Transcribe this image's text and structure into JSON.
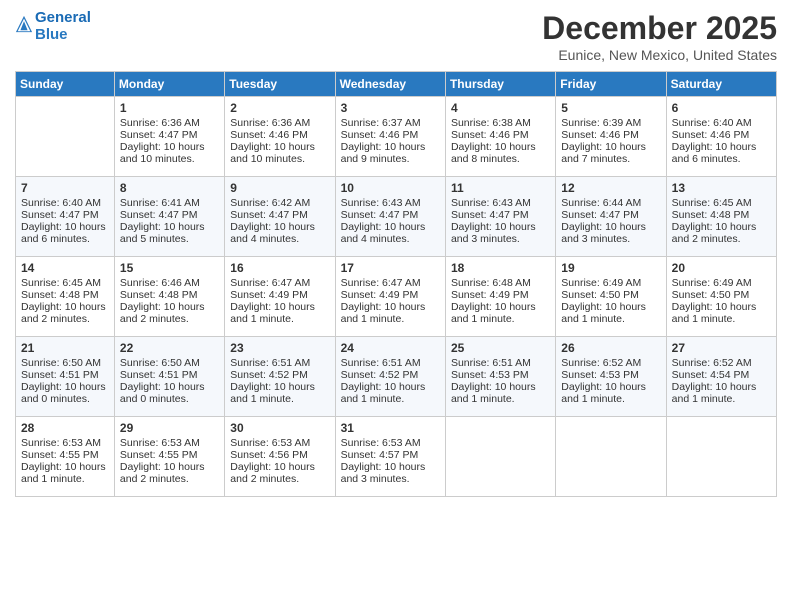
{
  "header": {
    "logo_line1": "General",
    "logo_line2": "Blue",
    "month": "December 2025",
    "location": "Eunice, New Mexico, United States"
  },
  "days_of_week": [
    "Sunday",
    "Monday",
    "Tuesday",
    "Wednesday",
    "Thursday",
    "Friday",
    "Saturday"
  ],
  "weeks": [
    [
      {
        "day": "",
        "info": ""
      },
      {
        "day": "1",
        "info": "Sunrise: 6:36 AM\nSunset: 4:47 PM\nDaylight: 10 hours and 10 minutes."
      },
      {
        "day": "2",
        "info": "Sunrise: 6:36 AM\nSunset: 4:46 PM\nDaylight: 10 hours and 10 minutes."
      },
      {
        "day": "3",
        "info": "Sunrise: 6:37 AM\nSunset: 4:46 PM\nDaylight: 10 hours and 9 minutes."
      },
      {
        "day": "4",
        "info": "Sunrise: 6:38 AM\nSunset: 4:46 PM\nDaylight: 10 hours and 8 minutes."
      },
      {
        "day": "5",
        "info": "Sunrise: 6:39 AM\nSunset: 4:46 PM\nDaylight: 10 hours and 7 minutes."
      },
      {
        "day": "6",
        "info": "Sunrise: 6:40 AM\nSunset: 4:46 PM\nDaylight: 10 hours and 6 minutes."
      }
    ],
    [
      {
        "day": "7",
        "info": "Sunrise: 6:40 AM\nSunset: 4:47 PM\nDaylight: 10 hours and 6 minutes."
      },
      {
        "day": "8",
        "info": "Sunrise: 6:41 AM\nSunset: 4:47 PM\nDaylight: 10 hours and 5 minutes."
      },
      {
        "day": "9",
        "info": "Sunrise: 6:42 AM\nSunset: 4:47 PM\nDaylight: 10 hours and 4 minutes."
      },
      {
        "day": "10",
        "info": "Sunrise: 6:43 AM\nSunset: 4:47 PM\nDaylight: 10 hours and 4 minutes."
      },
      {
        "day": "11",
        "info": "Sunrise: 6:43 AM\nSunset: 4:47 PM\nDaylight: 10 hours and 3 minutes."
      },
      {
        "day": "12",
        "info": "Sunrise: 6:44 AM\nSunset: 4:47 PM\nDaylight: 10 hours and 3 minutes."
      },
      {
        "day": "13",
        "info": "Sunrise: 6:45 AM\nSunset: 4:48 PM\nDaylight: 10 hours and 2 minutes."
      }
    ],
    [
      {
        "day": "14",
        "info": "Sunrise: 6:45 AM\nSunset: 4:48 PM\nDaylight: 10 hours and 2 minutes."
      },
      {
        "day": "15",
        "info": "Sunrise: 6:46 AM\nSunset: 4:48 PM\nDaylight: 10 hours and 2 minutes."
      },
      {
        "day": "16",
        "info": "Sunrise: 6:47 AM\nSunset: 4:49 PM\nDaylight: 10 hours and 1 minute."
      },
      {
        "day": "17",
        "info": "Sunrise: 6:47 AM\nSunset: 4:49 PM\nDaylight: 10 hours and 1 minute."
      },
      {
        "day": "18",
        "info": "Sunrise: 6:48 AM\nSunset: 4:49 PM\nDaylight: 10 hours and 1 minute."
      },
      {
        "day": "19",
        "info": "Sunrise: 6:49 AM\nSunset: 4:50 PM\nDaylight: 10 hours and 1 minute."
      },
      {
        "day": "20",
        "info": "Sunrise: 6:49 AM\nSunset: 4:50 PM\nDaylight: 10 hours and 1 minute."
      }
    ],
    [
      {
        "day": "21",
        "info": "Sunrise: 6:50 AM\nSunset: 4:51 PM\nDaylight: 10 hours and 0 minutes."
      },
      {
        "day": "22",
        "info": "Sunrise: 6:50 AM\nSunset: 4:51 PM\nDaylight: 10 hours and 0 minutes."
      },
      {
        "day": "23",
        "info": "Sunrise: 6:51 AM\nSunset: 4:52 PM\nDaylight: 10 hours and 1 minute."
      },
      {
        "day": "24",
        "info": "Sunrise: 6:51 AM\nSunset: 4:52 PM\nDaylight: 10 hours and 1 minute."
      },
      {
        "day": "25",
        "info": "Sunrise: 6:51 AM\nSunset: 4:53 PM\nDaylight: 10 hours and 1 minute."
      },
      {
        "day": "26",
        "info": "Sunrise: 6:52 AM\nSunset: 4:53 PM\nDaylight: 10 hours and 1 minute."
      },
      {
        "day": "27",
        "info": "Sunrise: 6:52 AM\nSunset: 4:54 PM\nDaylight: 10 hours and 1 minute."
      }
    ],
    [
      {
        "day": "28",
        "info": "Sunrise: 6:53 AM\nSunset: 4:55 PM\nDaylight: 10 hours and 1 minute."
      },
      {
        "day": "29",
        "info": "Sunrise: 6:53 AM\nSunset: 4:55 PM\nDaylight: 10 hours and 2 minutes."
      },
      {
        "day": "30",
        "info": "Sunrise: 6:53 AM\nSunset: 4:56 PM\nDaylight: 10 hours and 2 minutes."
      },
      {
        "day": "31",
        "info": "Sunrise: 6:53 AM\nSunset: 4:57 PM\nDaylight: 10 hours and 3 minutes."
      },
      {
        "day": "",
        "info": ""
      },
      {
        "day": "",
        "info": ""
      },
      {
        "day": "",
        "info": ""
      }
    ]
  ]
}
